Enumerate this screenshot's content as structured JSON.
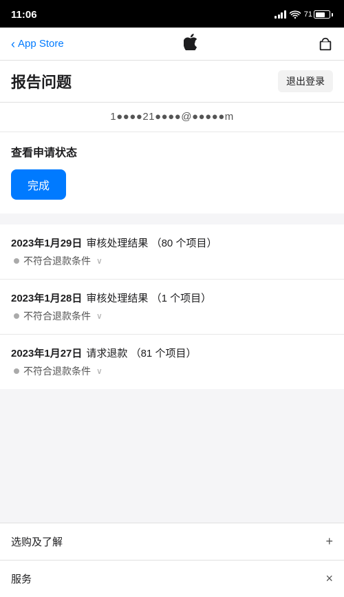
{
  "statusBar": {
    "time": "11:06",
    "batteryPercent": "71"
  },
  "navBar": {
    "backLabel": "App Store",
    "appleLogo": "",
    "bagIcon": "bag-icon"
  },
  "pageHeader": {
    "title": "报告问题",
    "logoutLabel": "退出登录"
  },
  "emailRow": {
    "email": "1●●●●21●●●●@●●●●●m"
  },
  "statusSection": {
    "title": "查看申请状态",
    "doneLabel": "完成"
  },
  "historyItems": [
    {
      "date": "2023年1月29日",
      "action": "审核处理结果",
      "count": "（80 个项目）",
      "statusText": "不符合退款条件"
    },
    {
      "date": "2023年1月28日",
      "action": "审核处理结果",
      "count": "（1 个项目）",
      "statusText": "不符合退款条件"
    },
    {
      "date": "2023年1月27日",
      "action": "请求退款",
      "count": "（81 个项目）",
      "statusText": "不符合退款条件"
    }
  ],
  "bottomSections": [
    {
      "label": "选购及了解",
      "icon": "+"
    },
    {
      "label": "服务",
      "icon": "×"
    }
  ]
}
